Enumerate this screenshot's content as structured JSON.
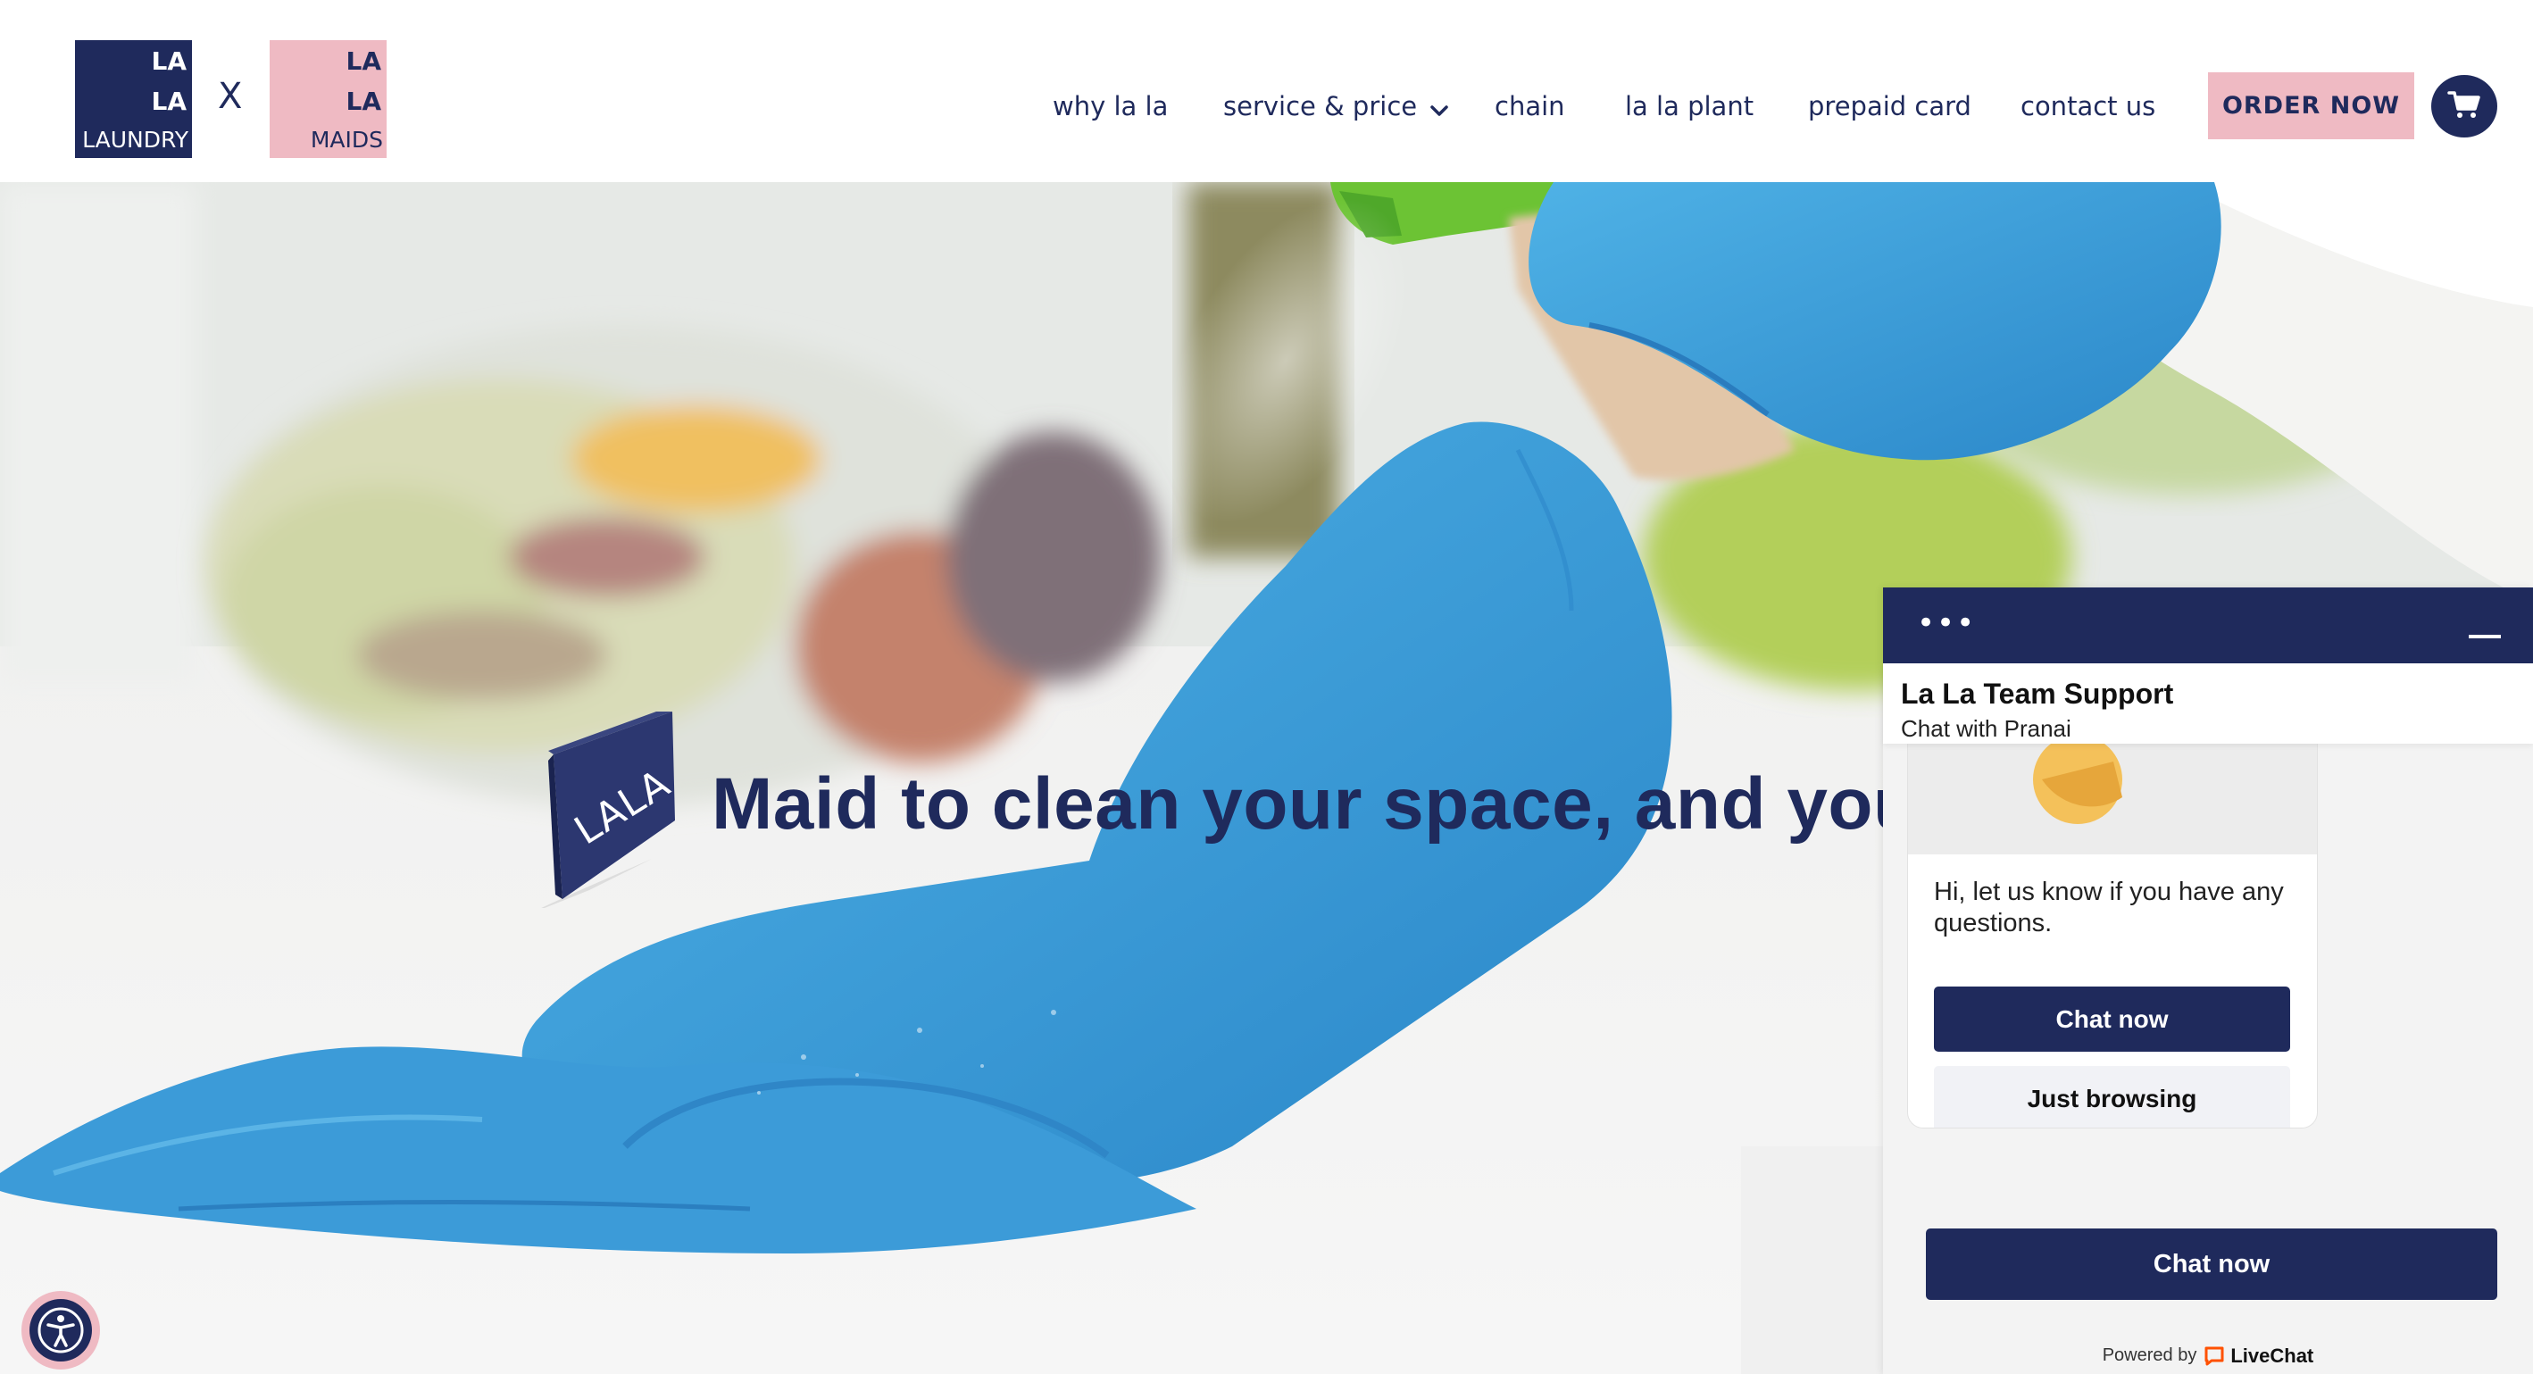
{
  "header": {
    "logo_laundry": {
      "line1": "LA",
      "line2": "LA",
      "line3": "LAUNDRY"
    },
    "logo_separator": "X",
    "logo_maids": {
      "line1": "LA",
      "line2": "LA",
      "line3": "MAIDS"
    },
    "nav": [
      {
        "label": "why la la"
      },
      {
        "label": "service & price"
      },
      {
        "label": "chain"
      },
      {
        "label": "la la plant"
      },
      {
        "label": "prepaid card"
      },
      {
        "label": "contact us"
      }
    ],
    "order_button": "ORDER NOW",
    "cart_icon": "cart-icon"
  },
  "hero": {
    "logo_text": "LALA",
    "heading": "Maid to clean your space, and your"
  },
  "accessibility": {
    "icon": "accessibility-icon"
  },
  "chat": {
    "menu_dots": "•••",
    "title": "La La Team Support",
    "subtitle": "Chat with Pranai",
    "message": "Hi, let us know if you have any questions.",
    "chat_now_button": "Chat now",
    "just_browsing_button": "Just browsing",
    "main_chat_button": "Chat now",
    "powered_by": "Powered by",
    "powered_brand": "LiveChat"
  },
  "colors": {
    "navy": "#1f2a5c",
    "pink": "#efbac3",
    "glove_blue": "#3a9fd6",
    "livechat_orange": "#ff5100"
  }
}
